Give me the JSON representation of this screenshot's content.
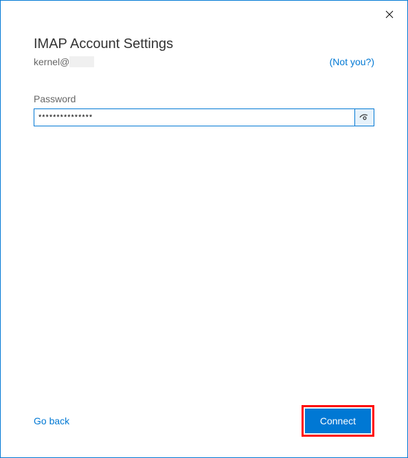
{
  "title": "IMAP Account Settings",
  "email_prefix": "kernel@",
  "not_you_label": "(Not you?)",
  "password_label": "Password",
  "password_value": "***************",
  "go_back_label": "Go back",
  "connect_label": "Connect"
}
